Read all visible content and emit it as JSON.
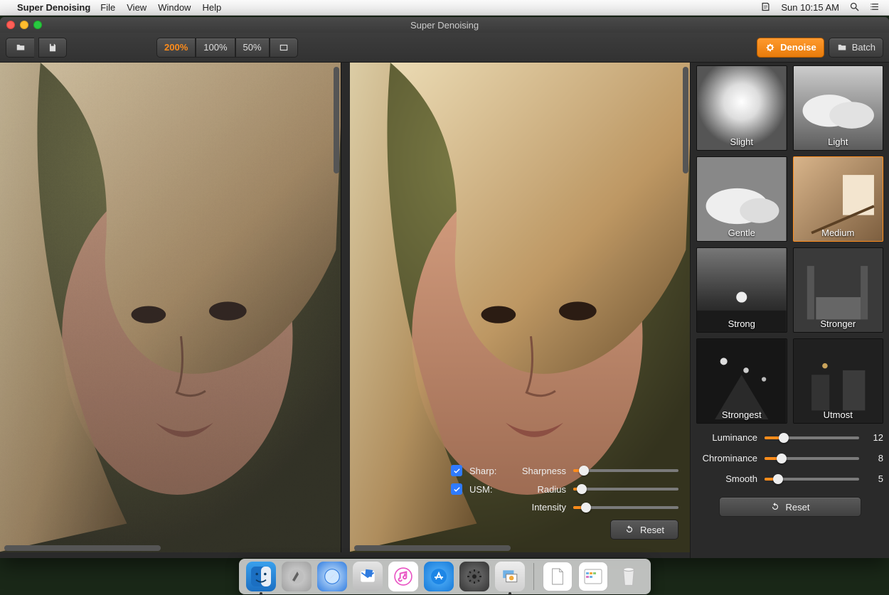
{
  "menubar": {
    "app": "Super Denoising",
    "items": [
      "File",
      "View",
      "Window",
      "Help"
    ],
    "clock": "Sun 10:15 AM"
  },
  "window": {
    "title": "Super Denoising"
  },
  "toolbar": {
    "zoom": [
      "200%",
      "100%",
      "50%"
    ],
    "active_zoom_index": 0,
    "tabs": {
      "denoise": "Denoise",
      "batch": "Batch",
      "active": "denoise"
    }
  },
  "overlay": {
    "sharp_label": "Sharp:",
    "usm_label": "USM:",
    "sharp_checked": true,
    "usm_checked": true,
    "rows": [
      {
        "param": "Sharpness",
        "pct": 10
      },
      {
        "param": "Radius",
        "pct": 8
      },
      {
        "param": "Intensity",
        "pct": 12
      }
    ],
    "reset": "Reset"
  },
  "presets": [
    {
      "label": "Slight",
      "selected": false,
      "kind": "sun"
    },
    {
      "label": "Light",
      "selected": false,
      "kind": "clouds"
    },
    {
      "label": "Gentle",
      "selected": false,
      "kind": "clouds2"
    },
    {
      "label": "Medium",
      "selected": true,
      "kind": "room"
    },
    {
      "label": "Strong",
      "selected": false,
      "kind": "sunset"
    },
    {
      "label": "Stronger",
      "selected": false,
      "kind": "porch"
    },
    {
      "label": "Strongest",
      "selected": false,
      "kind": "street1"
    },
    {
      "label": "Utmost",
      "selected": false,
      "kind": "street2"
    }
  ],
  "side_sliders": [
    {
      "label": "Luminance",
      "value": 12,
      "pct": 20
    },
    {
      "label": "Chrominance",
      "value": 8,
      "pct": 18
    },
    {
      "label": "Smooth",
      "value": 5,
      "pct": 14
    }
  ],
  "side_reset": "Reset",
  "accent": "#ff8c1a"
}
